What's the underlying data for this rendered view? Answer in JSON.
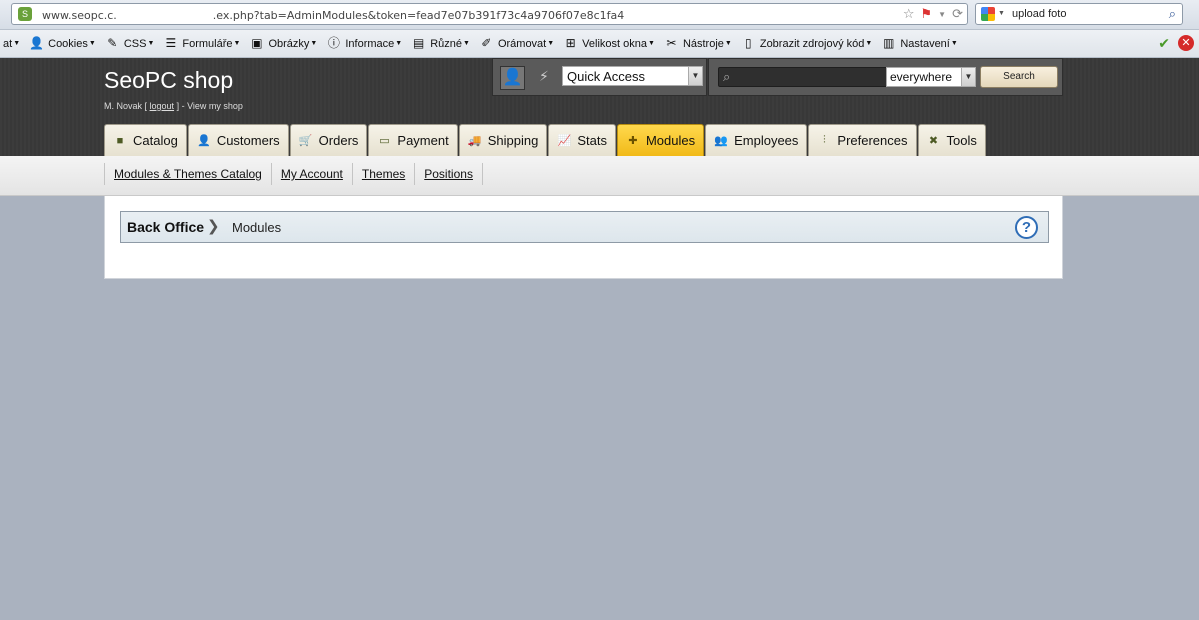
{
  "browser": {
    "url_prefix": "www.seopc.c.",
    "url_suffix": ".ex.php?tab=AdminModules&token=fead7e07b391f73c4a9706f07e8c1fa4",
    "search_value": "upload foto",
    "toolbar": [
      {
        "label": "at",
        "icon": "",
        "caret": true
      },
      {
        "label": "Cookies",
        "icon": "person-icon",
        "caret": true
      },
      {
        "label": "CSS",
        "icon": "pencil-icon",
        "caret": true
      },
      {
        "label": "Formuláře",
        "icon": "form-icon",
        "caret": true
      },
      {
        "label": "Obrázky",
        "icon": "image-icon",
        "caret": true
      },
      {
        "label": "Informace",
        "icon": "info-icon",
        "caret": true
      },
      {
        "label": "Různé",
        "icon": "misc-icon",
        "caret": true
      },
      {
        "label": "Orámovat",
        "icon": "outline-icon",
        "caret": true
      },
      {
        "label": "Velikost okna",
        "icon": "resize-icon",
        "caret": true
      },
      {
        "label": "Nástroje",
        "icon": "tools-icon",
        "caret": true
      },
      {
        "label": "Zobrazit zdrojový kód",
        "icon": "source-icon",
        "caret": true
      },
      {
        "label": "Nastavení",
        "icon": "settings-icon",
        "caret": true
      }
    ]
  },
  "header": {
    "shop_name": "SeoPC shop",
    "user": "M. Novak",
    "logout": "logout",
    "view_shop": "View my shop",
    "quick_access": "Quick Access",
    "search_scope": "everywhere",
    "search_button": "Search"
  },
  "tabs": [
    {
      "label": "Catalog",
      "icon": "catalog-icon",
      "glyph": "■",
      "active": false
    },
    {
      "label": "Customers",
      "icon": "customers-icon",
      "glyph": "👤",
      "active": false
    },
    {
      "label": "Orders",
      "icon": "orders-icon",
      "glyph": "🛒",
      "active": false
    },
    {
      "label": "Payment",
      "icon": "payment-icon",
      "glyph": "▭",
      "active": false
    },
    {
      "label": "Shipping",
      "icon": "shipping-icon",
      "glyph": "🚚",
      "active": false
    },
    {
      "label": "Stats",
      "icon": "stats-icon",
      "glyph": "📈",
      "active": false
    },
    {
      "label": "Modules",
      "icon": "modules-icon",
      "glyph": "✚",
      "active": true
    },
    {
      "label": "Employees",
      "icon": "employees-icon",
      "glyph": "👥",
      "active": false
    },
    {
      "label": "Preferences",
      "icon": "preferences-icon",
      "glyph": "⫶",
      "active": false
    },
    {
      "label": "Tools",
      "icon": "tools-icon",
      "glyph": "✖",
      "active": false
    }
  ],
  "subnav": [
    "Modules & Themes Catalog",
    "My Account",
    "Themes",
    "Positions"
  ],
  "breadcrumb": {
    "root": "Back Office",
    "current": "Modules"
  },
  "colors": {
    "active_tab": "#f1ba18",
    "header_bg": "#393939",
    "page_bg": "#aab2bf"
  }
}
